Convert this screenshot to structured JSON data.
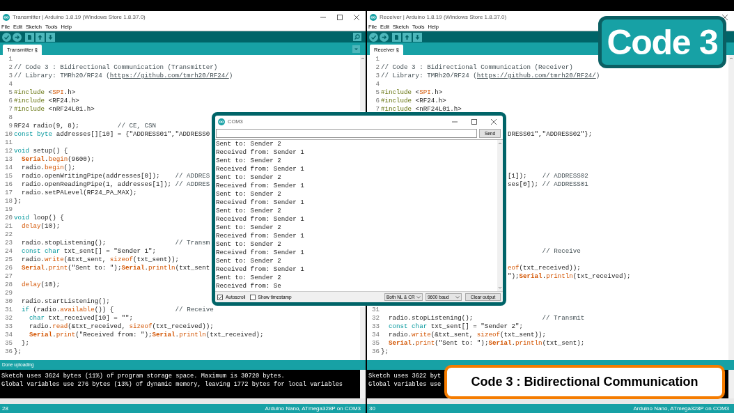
{
  "windows": [
    {
      "title": "Transmitter | Arduino 1.8.19 (Windows Store 1.8.37.0)",
      "menu": [
        "File",
        "Edit",
        "Sketch",
        "Tools",
        "Help"
      ],
      "tab": {
        "label": "Transmitter §",
        "selected": true
      },
      "editor": {
        "lines": [
          {
            "number": "1"
          },
          {
            "number": "2",
            "tokens": [
              {
                "kind": "comment",
                "text": "// Code 3 : Bidirectional Communication (Transmitter)"
              }
            ]
          },
          {
            "number": "3",
            "tokens": [
              {
                "kind": "comment",
                "text": "// Library: TMRh20/RF24 ("
              },
              {
                "kind": "link",
                "text": "https://github.com/tmrh20/RF24/"
              },
              {
                "kind": "comment",
                "text": ")"
              }
            ]
          },
          {
            "number": "4"
          },
          {
            "number": "5",
            "tokens": [
              {
                "kind": "preproc",
                "text": "#include"
              },
              {
                "kind": "plain",
                "text": " <"
              },
              {
                "kind": "function",
                "text": "SPI"
              },
              {
                "kind": "plain",
                "text": ".h>"
              }
            ]
          },
          {
            "number": "6",
            "tokens": [
              {
                "kind": "preproc",
                "text": "#include"
              },
              {
                "kind": "plain",
                "text": " <RF24.h>"
              }
            ]
          },
          {
            "number": "7",
            "tokens": [
              {
                "kind": "preproc",
                "text": "#include"
              },
              {
                "kind": "plain",
                "text": " <nRF24L01.h>"
              }
            ]
          },
          {
            "number": "8"
          },
          {
            "number": "9",
            "tokens": [
              {
                "kind": "plain",
                "text": "RF24 radio(9, 8);"
              },
              {
                "kind": "comment",
                "text": "          // CE, CSN"
              }
            ]
          },
          {
            "number": "10",
            "tokens": [
              {
                "kind": "keyword",
                "text": "const byte"
              },
              {
                "kind": "plain",
                "text": " addresses[][10] = {\"ADDRESS01\",\"ADDRESS0"
              }
            ]
          },
          {
            "number": "11"
          },
          {
            "number": "12",
            "tokens": [
              {
                "kind": "keyword",
                "text": "void"
              },
              {
                "kind": "plain",
                "text": " setup() {"
              }
            ]
          },
          {
            "number": "13",
            "tokens": [
              {
                "kind": "object",
                "text": "  Serial"
              },
              {
                "kind": "plain",
                "text": "."
              },
              {
                "kind": "function",
                "text": "begin"
              },
              {
                "kind": "plain",
                "text": "(9600);"
              }
            ]
          },
          {
            "number": "14",
            "tokens": [
              {
                "kind": "plain",
                "text": "  radio."
              },
              {
                "kind": "function",
                "text": "begin"
              },
              {
                "kind": "plain",
                "text": "();"
              }
            ]
          },
          {
            "number": "15",
            "tokens": [
              {
                "kind": "plain",
                "text": "  radio.openWritingPipe(addresses[0]);"
              },
              {
                "kind": "comment",
                "text": "    // ADDRES"
              }
            ]
          },
          {
            "number": "16",
            "tokens": [
              {
                "kind": "plain",
                "text": "  radio.openReadingPipe(1, addresses[1]);"
              },
              {
                "kind": "comment",
                "text": " // ADDRES"
              }
            ]
          },
          {
            "number": "17",
            "tokens": [
              {
                "kind": "plain",
                "text": "  radio.setPALevel(RF24_PA_MAX);"
              }
            ]
          },
          {
            "number": "18",
            "tokens": [
              {
                "kind": "plain",
                "text": "};"
              }
            ]
          },
          {
            "number": "19"
          },
          {
            "number": "20",
            "tokens": [
              {
                "kind": "keyword",
                "text": "void"
              },
              {
                "kind": "plain",
                "text": " loop() {"
              }
            ]
          },
          {
            "number": "21",
            "tokens": [
              {
                "kind": "function",
                "text": "  delay"
              },
              {
                "kind": "plain",
                "text": "(10);"
              }
            ]
          },
          {
            "number": "22"
          },
          {
            "number": "23",
            "tokens": [
              {
                "kind": "plain",
                "text": "  radio.stopListening();"
              },
              {
                "kind": "comment",
                "text": "                  // Transm"
              }
            ]
          },
          {
            "number": "24",
            "tokens": [
              {
                "kind": "keyword",
                "text": "  const char"
              },
              {
                "kind": "plain",
                "text": " txt_sent[] = \"Sender 1\";"
              }
            ]
          },
          {
            "number": "25",
            "tokens": [
              {
                "kind": "plain",
                "text": "  radio."
              },
              {
                "kind": "function",
                "text": "write"
              },
              {
                "kind": "plain",
                "text": "(&txt_sent, "
              },
              {
                "kind": "function",
                "text": "sizeof"
              },
              {
                "kind": "plain",
                "text": "(txt_sent));"
              }
            ]
          },
          {
            "number": "26",
            "tokens": [
              {
                "kind": "object",
                "text": "  Serial"
              },
              {
                "kind": "plain",
                "text": "."
              },
              {
                "kind": "function",
                "text": "print"
              },
              {
                "kind": "plain",
                "text": "(\"Sent to: \");"
              },
              {
                "kind": "object",
                "text": "Serial"
              },
              {
                "kind": "plain",
                "text": "."
              },
              {
                "kind": "function",
                "text": "println"
              },
              {
                "kind": "plain",
                "text": "(txt_sent"
              }
            ]
          },
          {
            "number": "27"
          },
          {
            "number": "28",
            "tokens": [
              {
                "kind": "function",
                "text": "  delay"
              },
              {
                "kind": "plain",
                "text": "(10);"
              }
            ]
          },
          {
            "number": "29"
          },
          {
            "number": "30",
            "tokens": [
              {
                "kind": "plain",
                "text": "  radio.startListening();"
              }
            ]
          },
          {
            "number": "31",
            "tokens": [
              {
                "kind": "keyword",
                "text": "  if"
              },
              {
                "kind": "plain",
                "text": " (radio."
              },
              {
                "kind": "function",
                "text": "available"
              },
              {
                "kind": "plain",
                "text": "()) {"
              },
              {
                "kind": "comment",
                "text": "                // Receive"
              }
            ]
          },
          {
            "number": "32",
            "tokens": [
              {
                "kind": "keyword",
                "text": "    char"
              },
              {
                "kind": "plain",
                "text": " txt_received[10] = \"\";"
              }
            ]
          },
          {
            "number": "33",
            "tokens": [
              {
                "kind": "plain",
                "text": "    radio."
              },
              {
                "kind": "function",
                "text": "read"
              },
              {
                "kind": "plain",
                "text": "(&txt_received, "
              },
              {
                "kind": "function",
                "text": "sizeof"
              },
              {
                "kind": "plain",
                "text": "(txt_received));"
              }
            ]
          },
          {
            "number": "34",
            "tokens": [
              {
                "kind": "object",
                "text": "    Serial"
              },
              {
                "kind": "plain",
                "text": "."
              },
              {
                "kind": "function",
                "text": "print"
              },
              {
                "kind": "plain",
                "text": "(\"Received from: \");"
              },
              {
                "kind": "object",
                "text": "Serial"
              },
              {
                "kind": "plain",
                "text": "."
              },
              {
                "kind": "function",
                "text": "println"
              },
              {
                "kind": "plain",
                "text": "(txt_received);"
              }
            ]
          },
          {
            "number": "35",
            "tokens": [
              {
                "kind": "plain",
                "text": "  };"
              }
            ]
          },
          {
            "number": "36",
            "tokens": [
              {
                "kind": "plain",
                "text": "};"
              }
            ]
          }
        ]
      },
      "status_message": "Done uploading",
      "console": [
        "Sketch uses 3624 bytes (11%) of program storage space. Maximum is 30720 bytes.",
        "Global variables use 276 bytes (13%) of dynamic memory, leaving 1772 bytes for local variables"
      ],
      "footer": {
        "line": "28",
        "board": "Arduino Nano, ATmega328P on COM3"
      }
    },
    {
      "title": "Receiver | Arduino 1.8.19 (Windows Store 1.8.37.0)",
      "menu": [
        "File",
        "Edit",
        "Sketch",
        "Tools",
        "Help"
      ],
      "tab": {
        "label": "Receiver §",
        "selected": true
      },
      "editor": {
        "lines": [
          {
            "number": "1"
          },
          {
            "number": "2",
            "tokens": [
              {
                "kind": "comment",
                "text": "// Code 3 : Bidirectional Communication (Receiver)"
              }
            ]
          },
          {
            "number": "3",
            "tokens": [
              {
                "kind": "comment",
                "text": "// Library: TMRh20/RF24 ("
              },
              {
                "kind": "link",
                "text": "https://github.com/tmrh20/RF24/"
              },
              {
                "kind": "comment",
                "text": ")"
              }
            ]
          },
          {
            "number": "4"
          },
          {
            "number": "5",
            "tokens": [
              {
                "kind": "preproc",
                "text": "#include"
              },
              {
                "kind": "plain",
                "text": " <"
              },
              {
                "kind": "function",
                "text": "SPI"
              },
              {
                "kind": "plain",
                "text": ".h>"
              }
            ]
          },
          {
            "number": "6",
            "tokens": [
              {
                "kind": "preproc",
                "text": "#include"
              },
              {
                "kind": "plain",
                "text": " <RF24.h>"
              }
            ]
          },
          {
            "number": "7",
            "tokens": [
              {
                "kind": "preproc",
                "text": "#include"
              },
              {
                "kind": "plain",
                "text": " <nRF24L01.h>"
              }
            ]
          },
          {
            "covered": true
          },
          {
            "covered": true
          },
          {
            "covered": true,
            "tokens": [
              {
                "kind": "plain",
                "text": "DRESS01\",\"ADDRESS02\"};"
              }
            ]
          },
          {
            "covered": true
          },
          {
            "covered": true
          },
          {
            "covered": true
          },
          {
            "covered": true
          },
          {
            "covered": true,
            "tokens": [
              {
                "kind": "plain",
                "text": "[1]);"
              },
              {
                "kind": "comment",
                "text": "    // ADDRESS02"
              }
            ]
          },
          {
            "covered": true,
            "tokens": [
              {
                "kind": "plain",
                "text": "ses[0]);"
              },
              {
                "kind": "comment",
                "text": " // ADDRESS01"
              }
            ]
          },
          {
            "covered": true
          },
          {
            "covered": true
          },
          {
            "covered": true
          },
          {
            "covered": true
          },
          {
            "covered": true
          },
          {
            "covered": true
          },
          {
            "covered": true
          },
          {
            "covered": true,
            "tokens": [
              {
                "kind": "comment",
                "text": "         // Receive"
              }
            ]
          },
          {
            "covered": true
          },
          {
            "covered": true,
            "tokens": [
              {
                "kind": "function",
                "text": "eof"
              },
              {
                "kind": "plain",
                "text": "(txt_received));"
              }
            ]
          },
          {
            "covered": true,
            "tokens": [
              {
                "kind": "plain",
                "text": "\");"
              },
              {
                "kind": "object",
                "text": "Serial"
              },
              {
                "kind": "plain",
                "text": "."
              },
              {
                "kind": "function",
                "text": "println"
              },
              {
                "kind": "plain",
                "text": "(txt_received);"
              }
            ]
          },
          {
            "covered": true
          },
          {
            "covered": true
          },
          {
            "covered": true
          },
          {
            "number": "31"
          },
          {
            "number": "32",
            "tokens": [
              {
                "kind": "plain",
                "text": "  radio.stopListening();"
              },
              {
                "kind": "comment",
                "text": "                  // Transmit"
              }
            ]
          },
          {
            "number": "33",
            "tokens": [
              {
                "kind": "keyword",
                "text": "  const char"
              },
              {
                "kind": "plain",
                "text": " txt_sent[] = \"Sender 2\";"
              }
            ]
          },
          {
            "number": "34",
            "tokens": [
              {
                "kind": "plain",
                "text": "  radio."
              },
              {
                "kind": "function",
                "text": "write"
              },
              {
                "kind": "plain",
                "text": "(&txt_sent, "
              },
              {
                "kind": "function",
                "text": "sizeof"
              },
              {
                "kind": "plain",
                "text": "(txt_sent));"
              }
            ]
          },
          {
            "number": "35",
            "tokens": [
              {
                "kind": "object",
                "text": "  Serial"
              },
              {
                "kind": "plain",
                "text": "."
              },
              {
                "kind": "function",
                "text": "print"
              },
              {
                "kind": "plain",
                "text": "(\"Sent to: \");"
              },
              {
                "kind": "object",
                "text": "Serial"
              },
              {
                "kind": "plain",
                "text": "."
              },
              {
                "kind": "function",
                "text": "println"
              },
              {
                "kind": "plain",
                "text": "(txt_sent);"
              }
            ]
          },
          {
            "number": "36",
            "tokens": [
              {
                "kind": "plain",
                "text": "};"
              }
            ]
          }
        ]
      },
      "console": [
        "Sketch uses 3622 byt",
        "Global variables use"
      ],
      "footer": {
        "line": "30",
        "board": "Arduino Nano, ATmega328P on COM3"
      }
    }
  ],
  "serial_monitor": {
    "title": "COM3",
    "send_button": "Send",
    "output": [
      "Sent to: Sender 2",
      "Received from: Sender 1",
      "Sent to: Sender 2",
      "Received from: Sender 1",
      "Sent to: Sender 2",
      "Received from: Sender 1",
      "Sent to: Sender 2",
      "Received from: Sender 1",
      "Sent to: Sender 2",
      "Received from: Sender 1",
      "Sent to: Sender 2",
      "Received from: Sender 1",
      "Sent to: Sender 2",
      "Received from: Sender 1",
      "Sent to: Sender 2",
      "Received from: Sender 1",
      "Sent to: Sender 2",
      "Received from: Se"
    ],
    "autoscroll": {
      "label": "Autoscroll",
      "checked": true
    },
    "show_timestamp": {
      "label": "Show timestamp",
      "checked": false
    },
    "line_ending": "Both NL & CR",
    "baud_rate": "9600 baud",
    "clear_button": "Clear output"
  },
  "overlays": {
    "title_badge": "Code 3",
    "caption": "Code 3 : Bidirectional Communication"
  }
}
